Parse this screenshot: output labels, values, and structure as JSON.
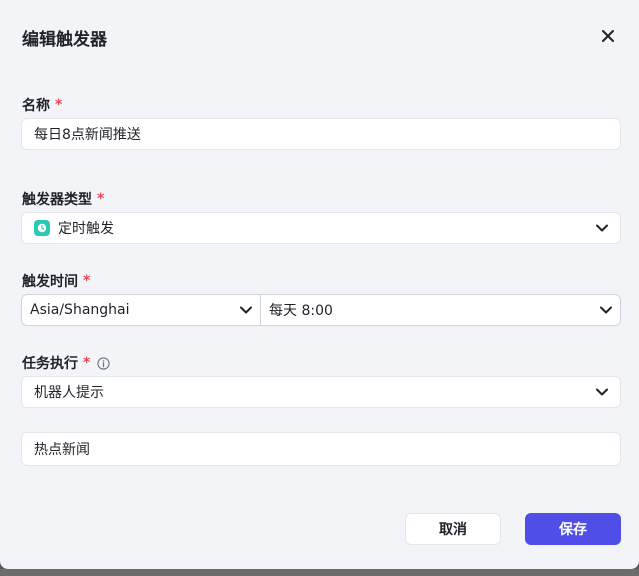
{
  "dialog": {
    "title": "编辑触发器",
    "close_icon": "close-icon"
  },
  "name_field": {
    "label": "名称",
    "required_mark": "*",
    "value": "每日8点新闻推送"
  },
  "trigger_type": {
    "label": "触发器类型",
    "required_mark": "*",
    "value": "定时触发",
    "icon": "clock-icon",
    "icon_color": "#2bc9b4"
  },
  "trigger_time": {
    "label": "触发时间",
    "required_mark": "*",
    "timezone": "Asia/Shanghai",
    "schedule": "每天 8:00"
  },
  "task": {
    "label": "任务执行",
    "required_mark": "*",
    "info_icon": "info-icon",
    "value": "机器人提示",
    "prompt_value": "热点新闻"
  },
  "buttons": {
    "cancel": "取消",
    "save": "保存"
  },
  "colors": {
    "primary": "#4f4fe8",
    "required": "#e5484d",
    "dialog_bg": "#f3f4f8"
  }
}
